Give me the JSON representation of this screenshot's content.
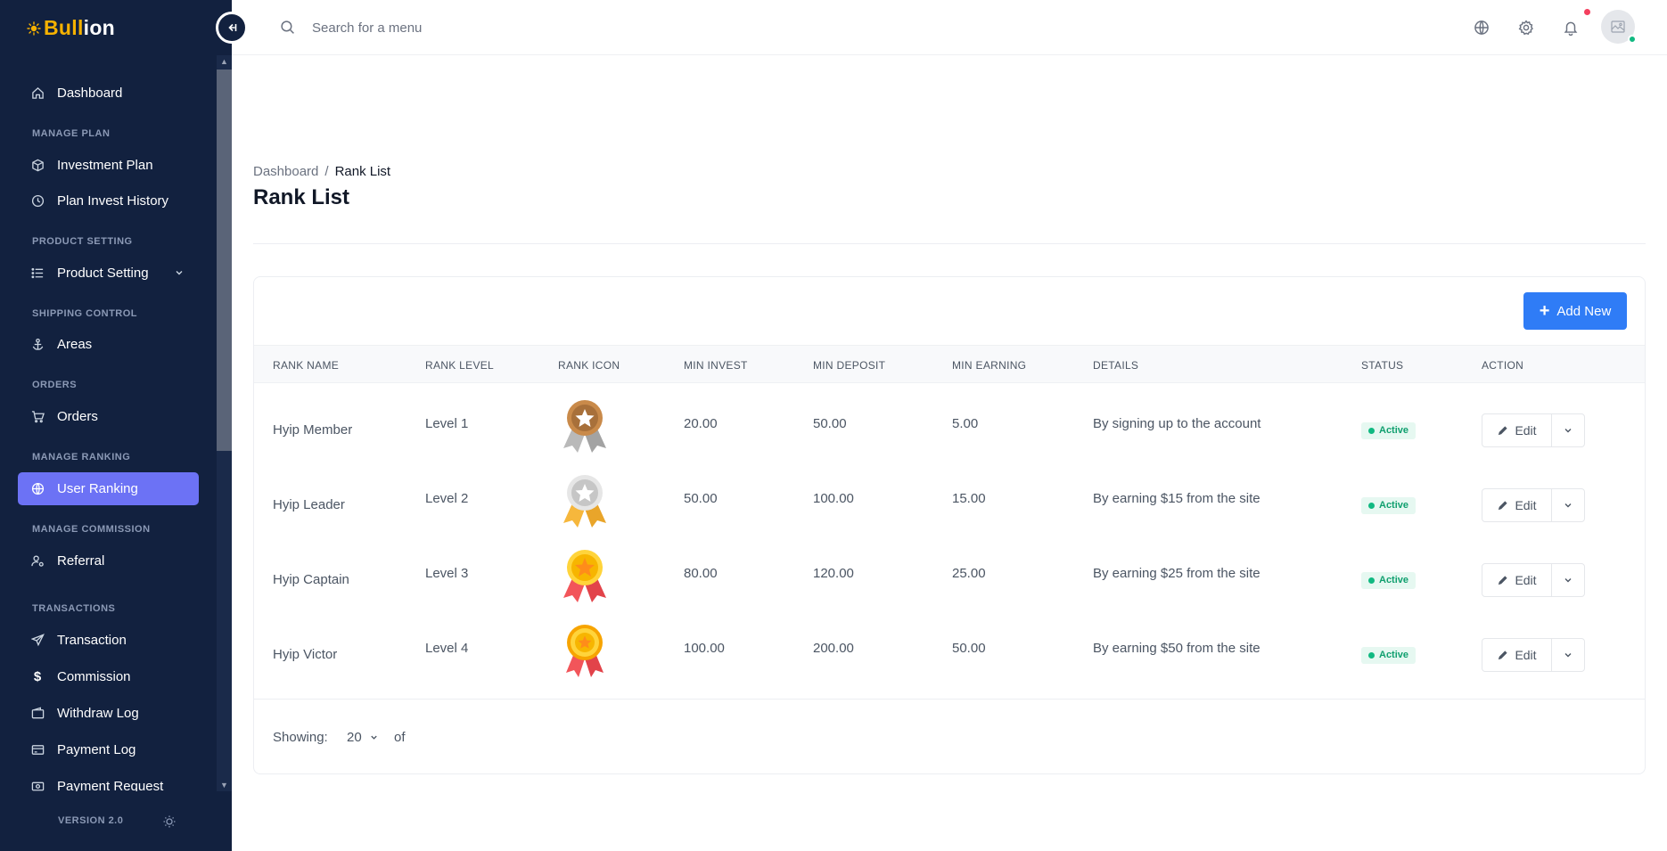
{
  "brand": {
    "part1": "Bull",
    "part2": "ion",
    "accent": "#f5b100"
  },
  "sidebar": {
    "items": [
      {
        "label": "Dashboard",
        "icon": "home-icon"
      },
      {
        "label": "Investment Plan",
        "icon": "box-icon"
      },
      {
        "label": "Plan Invest History",
        "icon": "clock-icon"
      },
      {
        "label": "Product Setting",
        "icon": "list-icon"
      },
      {
        "label": "Areas",
        "icon": "anchor-icon"
      },
      {
        "label": "Orders",
        "icon": "cart-icon"
      },
      {
        "label": "User Ranking",
        "icon": "globe-icon",
        "active": true
      },
      {
        "label": "Referral",
        "icon": "user-gear-icon"
      },
      {
        "label": "Transaction",
        "icon": "send-icon"
      },
      {
        "label": "Commission",
        "icon": "dollar-icon"
      },
      {
        "label": "Withdraw Log",
        "icon": "wallet-icon"
      },
      {
        "label": "Payment Log",
        "icon": "card-icon"
      },
      {
        "label": "Payment Request",
        "icon": "cash-icon"
      }
    ],
    "sections": [
      "MANAGE PLAN",
      "PRODUCT SETTING",
      "SHIPPING CONTROL",
      "ORDERS",
      "MANAGE RANKING",
      "MANAGE COMMISSION",
      "TRANSACTIONS"
    ],
    "version": "VERSION 2.0",
    "active_color": "#6c72f5"
  },
  "topbar": {
    "search_placeholder": "Search for a menu"
  },
  "breadcrumb": {
    "home": "Dashboard",
    "sep": "/",
    "current": "Rank List"
  },
  "page_title": "Rank List",
  "add_button": "Add New",
  "table": {
    "headers": [
      "RANK NAME",
      "RANK LEVEL",
      "RANK ICON",
      "MIN INVEST",
      "MIN DEPOSIT",
      "MIN EARNING",
      "DETAILS",
      "STATUS",
      "ACTION"
    ],
    "rows": [
      {
        "name": "Hyip Member",
        "level": "Level 1",
        "icon": "bronze-medal-icon",
        "min_invest": "20.00",
        "min_deposit": "50.00",
        "min_earning": "5.00",
        "details": "By signing up to the account",
        "status": "Active",
        "action": "Edit"
      },
      {
        "name": "Hyip Leader",
        "level": "Level 2",
        "icon": "silver-medal-icon",
        "min_invest": "50.00",
        "min_deposit": "100.00",
        "min_earning": "15.00",
        "details": "By earning $15 from the site",
        "status": "Active",
        "action": "Edit"
      },
      {
        "name": "Hyip Captain",
        "level": "Level 3",
        "icon": "gold-medal-icon",
        "min_invest": "80.00",
        "min_deposit": "120.00",
        "min_earning": "25.00",
        "details": "By earning $25 from the site",
        "status": "Active",
        "action": "Edit"
      },
      {
        "name": "Hyip Victor",
        "level": "Level 4",
        "icon": "gold-star-medal-icon",
        "min_invest": "100.00",
        "min_deposit": "200.00",
        "min_earning": "50.00",
        "details": "By earning $50 from the site",
        "status": "Active",
        "action": "Edit"
      }
    ]
  },
  "footer": {
    "showing_label": "Showing:",
    "per_page": "20",
    "of_label": "of"
  }
}
